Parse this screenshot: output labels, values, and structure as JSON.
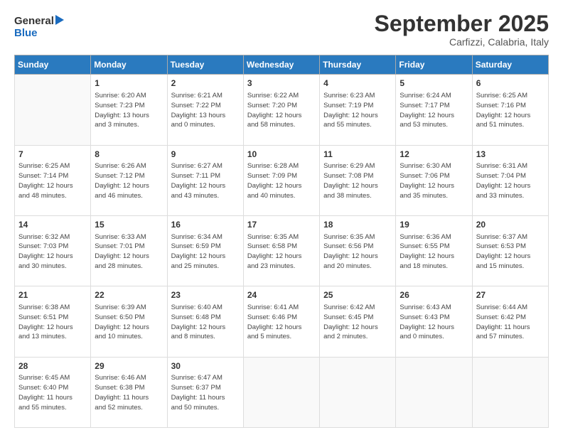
{
  "logo": {
    "line1": "General",
    "line2": "Blue"
  },
  "title": "September 2025",
  "location": "Carfizzi, Calabria, Italy",
  "weekdays": [
    "Sunday",
    "Monday",
    "Tuesday",
    "Wednesday",
    "Thursday",
    "Friday",
    "Saturday"
  ],
  "weeks": [
    [
      {
        "day": null,
        "info": null
      },
      {
        "day": "1",
        "info": "Sunrise: 6:20 AM\nSunset: 7:23 PM\nDaylight: 13 hours\nand 3 minutes."
      },
      {
        "day": "2",
        "info": "Sunrise: 6:21 AM\nSunset: 7:22 PM\nDaylight: 13 hours\nand 0 minutes."
      },
      {
        "day": "3",
        "info": "Sunrise: 6:22 AM\nSunset: 7:20 PM\nDaylight: 12 hours\nand 58 minutes."
      },
      {
        "day": "4",
        "info": "Sunrise: 6:23 AM\nSunset: 7:19 PM\nDaylight: 12 hours\nand 55 minutes."
      },
      {
        "day": "5",
        "info": "Sunrise: 6:24 AM\nSunset: 7:17 PM\nDaylight: 12 hours\nand 53 minutes."
      },
      {
        "day": "6",
        "info": "Sunrise: 6:25 AM\nSunset: 7:16 PM\nDaylight: 12 hours\nand 51 minutes."
      }
    ],
    [
      {
        "day": "7",
        "info": "Sunrise: 6:25 AM\nSunset: 7:14 PM\nDaylight: 12 hours\nand 48 minutes."
      },
      {
        "day": "8",
        "info": "Sunrise: 6:26 AM\nSunset: 7:12 PM\nDaylight: 12 hours\nand 46 minutes."
      },
      {
        "day": "9",
        "info": "Sunrise: 6:27 AM\nSunset: 7:11 PM\nDaylight: 12 hours\nand 43 minutes."
      },
      {
        "day": "10",
        "info": "Sunrise: 6:28 AM\nSunset: 7:09 PM\nDaylight: 12 hours\nand 40 minutes."
      },
      {
        "day": "11",
        "info": "Sunrise: 6:29 AM\nSunset: 7:08 PM\nDaylight: 12 hours\nand 38 minutes."
      },
      {
        "day": "12",
        "info": "Sunrise: 6:30 AM\nSunset: 7:06 PM\nDaylight: 12 hours\nand 35 minutes."
      },
      {
        "day": "13",
        "info": "Sunrise: 6:31 AM\nSunset: 7:04 PM\nDaylight: 12 hours\nand 33 minutes."
      }
    ],
    [
      {
        "day": "14",
        "info": "Sunrise: 6:32 AM\nSunset: 7:03 PM\nDaylight: 12 hours\nand 30 minutes."
      },
      {
        "day": "15",
        "info": "Sunrise: 6:33 AM\nSunset: 7:01 PM\nDaylight: 12 hours\nand 28 minutes."
      },
      {
        "day": "16",
        "info": "Sunrise: 6:34 AM\nSunset: 6:59 PM\nDaylight: 12 hours\nand 25 minutes."
      },
      {
        "day": "17",
        "info": "Sunrise: 6:35 AM\nSunset: 6:58 PM\nDaylight: 12 hours\nand 23 minutes."
      },
      {
        "day": "18",
        "info": "Sunrise: 6:35 AM\nSunset: 6:56 PM\nDaylight: 12 hours\nand 20 minutes."
      },
      {
        "day": "19",
        "info": "Sunrise: 6:36 AM\nSunset: 6:55 PM\nDaylight: 12 hours\nand 18 minutes."
      },
      {
        "day": "20",
        "info": "Sunrise: 6:37 AM\nSunset: 6:53 PM\nDaylight: 12 hours\nand 15 minutes."
      }
    ],
    [
      {
        "day": "21",
        "info": "Sunrise: 6:38 AM\nSunset: 6:51 PM\nDaylight: 12 hours\nand 13 minutes."
      },
      {
        "day": "22",
        "info": "Sunrise: 6:39 AM\nSunset: 6:50 PM\nDaylight: 12 hours\nand 10 minutes."
      },
      {
        "day": "23",
        "info": "Sunrise: 6:40 AM\nSunset: 6:48 PM\nDaylight: 12 hours\nand 8 minutes."
      },
      {
        "day": "24",
        "info": "Sunrise: 6:41 AM\nSunset: 6:46 PM\nDaylight: 12 hours\nand 5 minutes."
      },
      {
        "day": "25",
        "info": "Sunrise: 6:42 AM\nSunset: 6:45 PM\nDaylight: 12 hours\nand 2 minutes."
      },
      {
        "day": "26",
        "info": "Sunrise: 6:43 AM\nSunset: 6:43 PM\nDaylight: 12 hours\nand 0 minutes."
      },
      {
        "day": "27",
        "info": "Sunrise: 6:44 AM\nSunset: 6:42 PM\nDaylight: 11 hours\nand 57 minutes."
      }
    ],
    [
      {
        "day": "28",
        "info": "Sunrise: 6:45 AM\nSunset: 6:40 PM\nDaylight: 11 hours\nand 55 minutes."
      },
      {
        "day": "29",
        "info": "Sunrise: 6:46 AM\nSunset: 6:38 PM\nDaylight: 11 hours\nand 52 minutes."
      },
      {
        "day": "30",
        "info": "Sunrise: 6:47 AM\nSunset: 6:37 PM\nDaylight: 11 hours\nand 50 minutes."
      },
      {
        "day": null,
        "info": null
      },
      {
        "day": null,
        "info": null
      },
      {
        "day": null,
        "info": null
      },
      {
        "day": null,
        "info": null
      }
    ]
  ]
}
